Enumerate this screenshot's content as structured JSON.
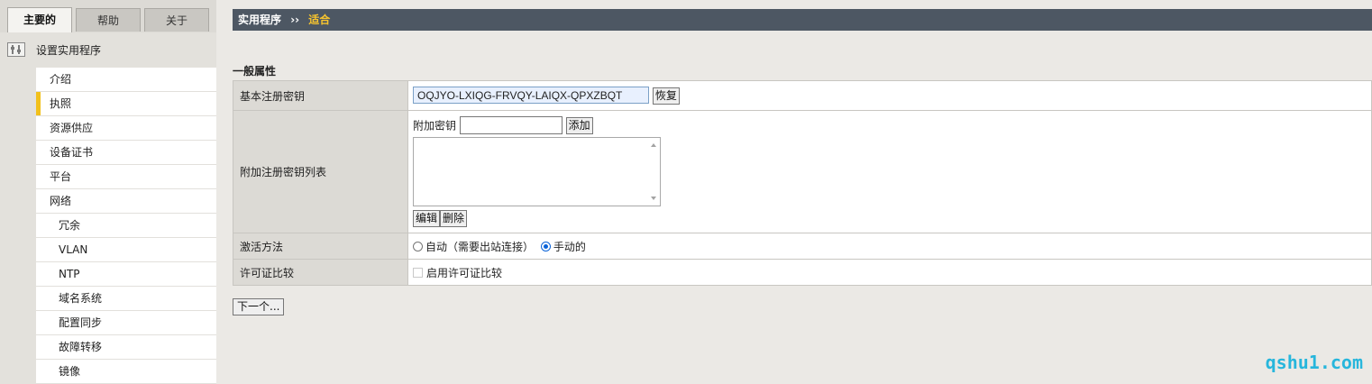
{
  "tabs": [
    {
      "label": "主要的",
      "active": true
    },
    {
      "label": "帮助",
      "active": false
    },
    {
      "label": "关于",
      "active": false
    }
  ],
  "sidebar": {
    "title": "设置实用程序",
    "items": [
      {
        "label": "介绍",
        "sub": false,
        "active": false
      },
      {
        "label": "执照",
        "sub": false,
        "active": true
      },
      {
        "label": "资源供应",
        "sub": false,
        "active": false
      },
      {
        "label": "设备证书",
        "sub": false,
        "active": false
      },
      {
        "label": "平台",
        "sub": false,
        "active": false
      },
      {
        "label": "网络",
        "sub": false,
        "active": false
      },
      {
        "label": "冗余",
        "sub": true,
        "active": false
      },
      {
        "label": "VLAN",
        "sub": true,
        "active": false
      },
      {
        "label": "NTP",
        "sub": true,
        "active": false
      },
      {
        "label": "域名系统",
        "sub": true,
        "active": false
      },
      {
        "label": "配置同步",
        "sub": true,
        "active": false
      },
      {
        "label": "故障转移",
        "sub": true,
        "active": false
      },
      {
        "label": "镜像",
        "sub": true,
        "active": false
      }
    ]
  },
  "breadcrumb": {
    "root": "实用程序",
    "separator": "››",
    "current": "适合"
  },
  "section": {
    "title": "一般属性"
  },
  "form": {
    "base_key_label": "基本注册密钥",
    "base_key_value": "OQJYO-LXIQG-FRVQY-LAIQX-QPXZBQT",
    "restore_button": "恢复",
    "addl_list_label": "附加注册密钥列表",
    "addl_key_label": "附加密钥",
    "addl_key_value": "",
    "add_button": "添加",
    "edit_button": "编辑",
    "delete_button": "删除",
    "activation_label": "激活方法",
    "activation_auto": "自动（需要出站连接）",
    "activation_manual": "手动的",
    "activation_selected": "manual",
    "license_compare_label": "许可证比较",
    "license_compare_option": "启用许可证比较"
  },
  "next_button": "下一个...",
  "watermark": "qshu1.com",
  "colors": {
    "breadcrumb_bg": "#4d5763",
    "breadcrumb_current": "#f7c42e",
    "active_nav_marker": "#f2c01b",
    "watermark": "#27b6dc"
  }
}
